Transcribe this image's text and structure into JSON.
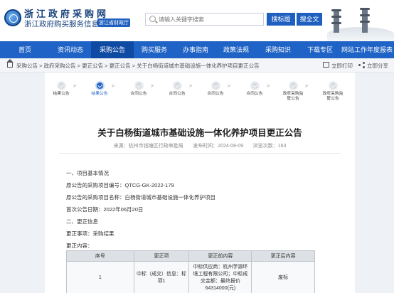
{
  "header": {
    "site_title": "浙江政府采购网",
    "site_subtitle": "浙江政府购买服务信息平台",
    "site_badge": "浙江省财政厅",
    "search_placeholder": "请输入关键字搜索",
    "search_button": "搜标题",
    "fulltext_button": "搜全文"
  },
  "nav": {
    "items": [
      {
        "label": "首页"
      },
      {
        "label": "资讯动态"
      },
      {
        "label": "采购公告"
      },
      {
        "label": "购买服务"
      },
      {
        "label": "办事指南"
      },
      {
        "label": "政策法规"
      },
      {
        "label": "采购知识"
      },
      {
        "label": "下载专区"
      },
      {
        "label": "网站工作年度报表"
      }
    ],
    "active_index": 2
  },
  "breadcrumb": {
    "text": "采购公告 > 政府采购公告 > 更正公告 > 更正公告 > 关于白杨街道城市基础设施一体化养护项目更正公告",
    "print_label": "立即打印",
    "share_label": "立即分享"
  },
  "progress": {
    "steps": [
      {
        "label": "结果公告",
        "active": false
      },
      {
        "label": "结果公告",
        "active": true
      },
      {
        "label": "合同公告",
        "active": false
      },
      {
        "label": "合同公告",
        "active": false
      },
      {
        "label": "合同公告",
        "active": false
      },
      {
        "label": "合同公告",
        "active": false
      },
      {
        "label": "政府采购监管公告",
        "active": false
      },
      {
        "label": "政府采购监管公告",
        "active": false
      }
    ]
  },
  "article": {
    "title": "关于白杨街道城市基础设施一体化养护项目更正公告",
    "source_label": "来源：",
    "source": "杭州市钱塘区行政审批局",
    "date_label": "发布时间：",
    "date": "2024-08-09",
    "views_label": "浏览次数：",
    "views": "163",
    "section1": "一、项目基本情况",
    "project_no_label": "原公告的采购项目编号：",
    "project_no": "QTCG-GK-2022-179",
    "project_name_label": "原公告的采购项目名称：",
    "project_name": "白杨街道城市基础设施一体化养护项目",
    "first_date_label": "首次公告日期：",
    "first_date": "2022年06月20日",
    "section2": "二、更正信息",
    "change_item_label": "更正事项：",
    "change_item": "采购结果",
    "change_content_label": "更正内容："
  },
  "table": {
    "headers": [
      "序号",
      "更正项",
      "更正前内容",
      "更正后内容"
    ],
    "rows": [
      [
        "1",
        "中标（成交）信息：标项1",
        "中标供应商：杭州学源环境工程有限公司；中标成交金额：最终报价64314000(元)",
        "废标"
      ]
    ]
  },
  "colors": {
    "primary": "#1f63c6",
    "nav_active": "#0f4aa3"
  }
}
